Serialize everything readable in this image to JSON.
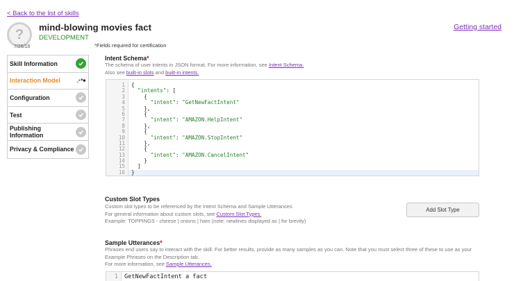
{
  "nav": {
    "back_link": "< Back to the list of skills",
    "getting_started": "Getting started"
  },
  "skill": {
    "icon_glyph": "?",
    "name": "mind-blowing movies fact",
    "status": "DEVELOPMENT",
    "date": "7/26/16"
  },
  "required_note": {
    "star": "*",
    "text": "Fields required for certification"
  },
  "sidebar": {
    "items": [
      {
        "label": "Skill Information",
        "status": "done",
        "icon": "checkmark-icon"
      },
      {
        "label": "Interaction Model",
        "status": "active",
        "icon": "loading-spinner-icon"
      },
      {
        "label": "Configuration",
        "status": "todo",
        "icon": "checkmark-icon"
      },
      {
        "label": "Test",
        "status": "todo",
        "icon": "checkmark-icon"
      },
      {
        "label": "Publishing Information",
        "status": "todo",
        "icon": "checkmark-icon"
      },
      {
        "label": "Privacy & Compliance",
        "status": "todo",
        "icon": "checkmark-icon"
      }
    ]
  },
  "intent_schema": {
    "title": "Intent Schema",
    "star": "*",
    "desc_line1": "The schema of user intents in JSON format. For more information, see ",
    "desc_link1": "Intent Schema.",
    "desc_line2": "Also see ",
    "desc_link2": "built-in slots",
    "desc_and": " and ",
    "desc_link3": "built-in intents.",
    "code_lines": [
      {
        "n": "1",
        "text": "{"
      },
      {
        "n": "2",
        "text": "  \"intents\": ["
      },
      {
        "n": "3",
        "text": "    {"
      },
      {
        "n": "4",
        "text": "      \"intent\": \"GetNewFactIntent\""
      },
      {
        "n": "5",
        "text": "    },"
      },
      {
        "n": "6",
        "text": "    {"
      },
      {
        "n": "7",
        "text": "      \"intent\": \"AMAZON.HelpIntent\""
      },
      {
        "n": "8",
        "text": "    },"
      },
      {
        "n": "9",
        "text": "    {"
      },
      {
        "n": "10",
        "text": "      \"intent\": \"AMAZON.StopIntent\""
      },
      {
        "n": "11",
        "text": "    },"
      },
      {
        "n": "12",
        "text": "    {"
      },
      {
        "n": "13",
        "text": "      \"intent\": \"AMAZON.CancelIntent\""
      },
      {
        "n": "14",
        "text": "    }"
      },
      {
        "n": "15",
        "text": "  ]"
      },
      {
        "n": "16",
        "text": "}"
      }
    ]
  },
  "custom_slots": {
    "title": "Custom Slot Types",
    "desc_line1": "Custom slot types to be referenced by the Intent Schema and Sample Utterances",
    "desc_line2": "For general information about custom slots, see ",
    "desc_link": "Custom Slot Types.",
    "desc_line3": "Example: TOPPINGS - cheese | onions | ham (note: newlines displayed as | for brevity)",
    "add_button": "Add Slot Type"
  },
  "sample_utterances": {
    "title": "Sample Utterances",
    "star": "*",
    "desc_line1": "Phrases end users say to interact with the skill. For better results, provide as many samples as you can. Note that you must select three of these to use as your",
    "desc_line2": "Example Phrases on the Description tab.",
    "desc_line3": "For more information, see ",
    "desc_link": "Sample Utterances.",
    "first_line_num": "1",
    "first_line": "GetNewFactIntent a fact"
  },
  "colors": {
    "link": "#7a2fb5",
    "status_green": "#2e8b2e",
    "active_orange": "#e38b2d",
    "required_red": "#dd0000"
  }
}
